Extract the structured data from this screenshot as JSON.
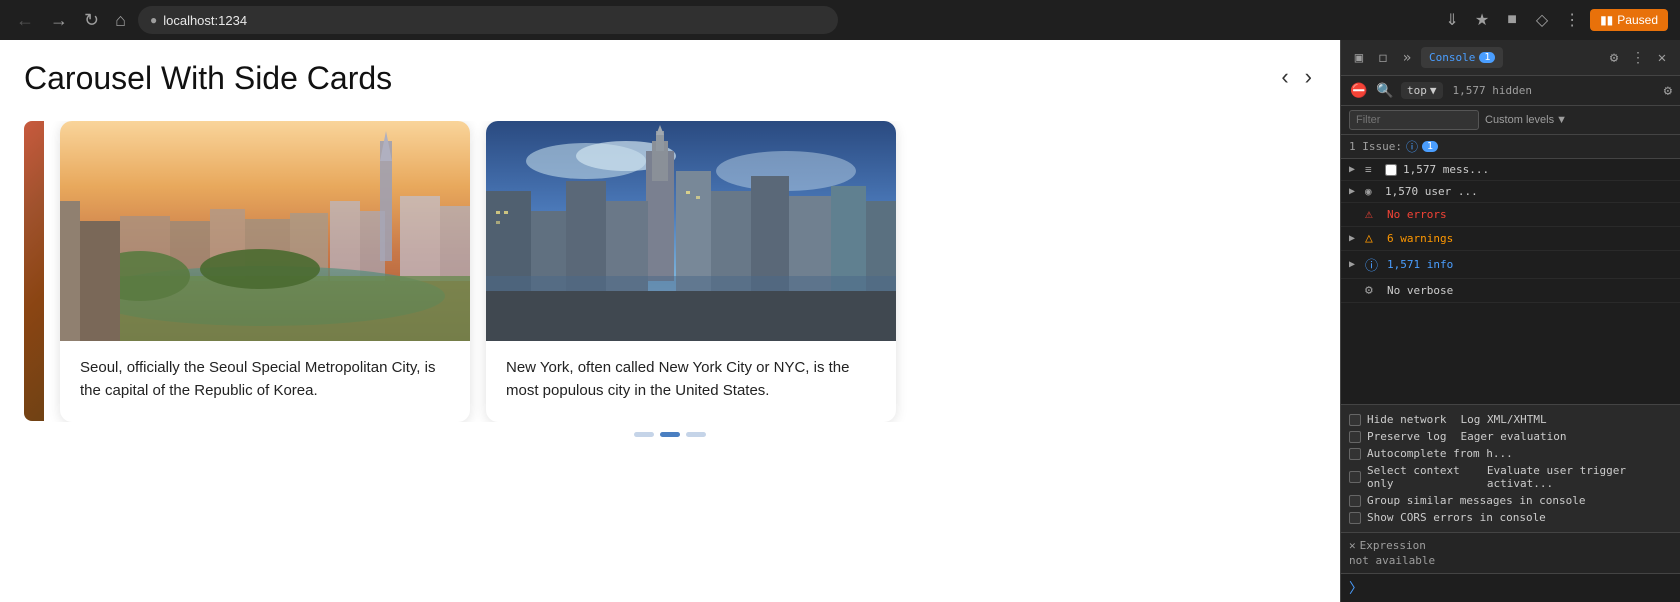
{
  "browser": {
    "url": "localhost:1234",
    "paused_label": "Paused"
  },
  "page": {
    "title": "Carousel With Side Cards",
    "nav_prev": "‹",
    "nav_next": "›"
  },
  "cards": [
    {
      "city": "Seoul",
      "description": "Seoul, officially the Seoul Special Metropolitan City, is the capital of the Republic of Korea."
    },
    {
      "city": "New York",
      "description": "New York, often called New York City or NYC, is the most populous city in the United States."
    }
  ],
  "devtools": {
    "tab_label": "1",
    "context": "top",
    "hidden_count": "1,577 hidden",
    "filter_placeholder": "Filter",
    "custom_levels": "Custom levels",
    "issues_label": "1 Issue:",
    "issues_count": "1",
    "log_rows": [
      {
        "type": "default",
        "icon": "≡",
        "text": "1,577 mess...",
        "has_expand": true,
        "has_checkbox": true
      },
      {
        "type": "default",
        "icon": "⊙",
        "text": "1,570 user ...",
        "has_expand": true,
        "has_checkbox": false
      },
      {
        "type": "error",
        "icon": "⊗",
        "text": "No errors",
        "has_expand": false,
        "has_checkbox": false
      },
      {
        "type": "warning",
        "icon": "⚠",
        "text": "6 warnings",
        "has_expand": true,
        "has_checkbox": false
      },
      {
        "type": "info",
        "icon": "ℹ",
        "text": "1,571 info",
        "has_expand": true,
        "has_checkbox": false
      },
      {
        "type": "default",
        "icon": "⚙",
        "text": "No verbose",
        "has_expand": false,
        "has_checkbox": false
      }
    ],
    "settings": [
      {
        "label": "Hide network",
        "checked": false
      },
      {
        "label": "XML/XHTML",
        "checked": false
      },
      {
        "label": "Preserve log",
        "checked": false
      },
      {
        "label": "Eager evaluation",
        "checked": false
      },
      {
        "label": "Autocomplete from history",
        "checked": false
      },
      {
        "label": "Select context only",
        "checked": false
      },
      {
        "label": "Evaluate triggers user activation",
        "checked": false
      },
      {
        "label": "Group similar messages",
        "checked": false
      },
      {
        "label": "Show CORS errors in console",
        "checked": false
      }
    ],
    "expression_label": "Expression",
    "expression_value": "not available"
  },
  "dots": [
    {
      "state": "inactive"
    },
    {
      "state": "active"
    },
    {
      "state": "inactive"
    }
  ]
}
